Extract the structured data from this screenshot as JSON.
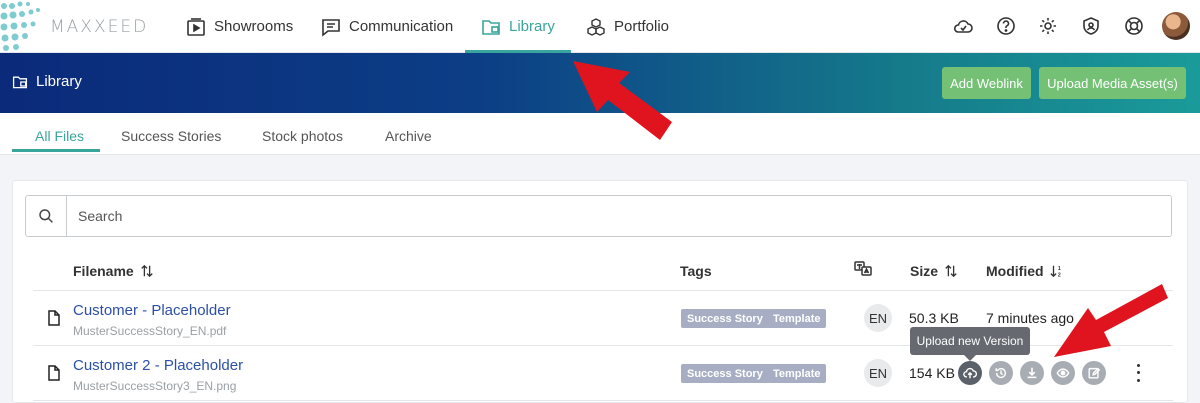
{
  "brand": {
    "name": "MAXXEED"
  },
  "nav": {
    "items": [
      {
        "label": "Showrooms",
        "icon": "showroom-icon"
      },
      {
        "label": "Communication",
        "icon": "chat-icon"
      },
      {
        "label": "Library",
        "icon": "folder-library-icon",
        "active": true
      },
      {
        "label": "Portfolio",
        "icon": "cubes-icon"
      }
    ],
    "right_icons": [
      "cloud-sync-icon",
      "help-icon",
      "gear-icon",
      "shield-icon",
      "support-lifebuoy-icon",
      "avatar"
    ]
  },
  "header": {
    "title": "Library",
    "buttons": {
      "add_weblink": "Add Weblink",
      "upload_media": "Upload Media Asset(s)"
    }
  },
  "tabs": [
    {
      "label": "All Files",
      "active": true
    },
    {
      "label": "Success Stories"
    },
    {
      "label": "Stock photos"
    },
    {
      "label": "Archive"
    }
  ],
  "search": {
    "placeholder": "Search"
  },
  "table": {
    "columns": {
      "filename": "Filename",
      "tags": "Tags",
      "language_icon": "translate-icon",
      "size": "Size",
      "modified": "Modified"
    },
    "rows": [
      {
        "filename": "Customer - Placeholder",
        "file": "MusterSuccessStory_EN.pdf",
        "tags": [
          "Success Story",
          "Template"
        ],
        "lang": "EN",
        "size": "50.3 KB",
        "modified": "7 minutes ago"
      },
      {
        "filename": "Customer 2 - Placeholder",
        "file": "MusterSuccessStory3_EN.png",
        "tags": [
          "Success Story",
          "Template"
        ],
        "lang": "EN",
        "size": "154 KB",
        "modified": ""
      }
    ],
    "row_actions": [
      "upload-version-icon",
      "history-icon",
      "download-icon",
      "preview-eye-icon",
      "edit-icon",
      "more-vertical-icon"
    ]
  },
  "tooltip": {
    "text": "Upload new Version"
  },
  "colors": {
    "accent": "#3aa59c",
    "header_start": "#0b2a7a",
    "header_end": "#1a9b9a",
    "button_green": "#74c176",
    "tag_bg": "#a7aec4",
    "annotation_red": "#e0141e"
  }
}
